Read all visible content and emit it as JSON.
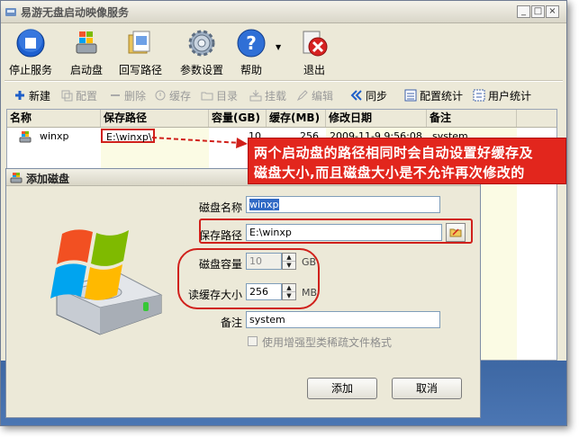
{
  "window": {
    "title": "易游无盘启动映像服务"
  },
  "toolbar": [
    {
      "label": "停止服务",
      "icon": "stop-service-icon"
    },
    {
      "label": "启动盘",
      "icon": "boot-disk-icon"
    },
    {
      "label": "回写路径",
      "icon": "writeback-path-icon"
    },
    {
      "label": "参数设置",
      "icon": "settings-gear-icon"
    },
    {
      "label": "帮助",
      "icon": "help-icon"
    },
    {
      "label": "退出",
      "icon": "exit-icon"
    }
  ],
  "toolbar2": [
    {
      "label": "新建",
      "icon": "plus-icon",
      "enabled": true
    },
    {
      "label": "配置",
      "icon": "config-icon",
      "enabled": false
    },
    {
      "label": "删除",
      "icon": "minus-icon",
      "enabled": false
    },
    {
      "label": "缓存",
      "icon": "cache-icon",
      "enabled": false
    },
    {
      "label": "目录",
      "icon": "folder-icon",
      "enabled": false
    },
    {
      "label": "挂载",
      "icon": "mount-icon",
      "enabled": false
    },
    {
      "label": "编辑",
      "icon": "edit-icon",
      "enabled": false
    },
    {
      "label": "同步",
      "icon": "sync-icon",
      "enabled": true
    },
    {
      "label": "配置统计",
      "icon": "config-stats-icon",
      "enabled": true
    },
    {
      "label": "用户统计",
      "icon": "user-stats-icon",
      "enabled": true
    }
  ],
  "table": {
    "headers": [
      "名称",
      "保存路径",
      "容量(GB)",
      "缓存(MB)",
      "修改日期",
      "备注"
    ],
    "rows": [
      [
        "winxp",
        "E:\\winxp\\",
        "10",
        "256",
        "2009-11-9 9:56:08",
        "system"
      ]
    ]
  },
  "callout": {
    "line1": "两个启动盘的路径相同时会自动设置好缓存及",
    "line2": "磁盘大小,而且磁盘大小是不允许再次修改的"
  },
  "dialog": {
    "title": "添加磁盘",
    "disk_name_label": "磁盘名称",
    "disk_name_value": "winxp",
    "save_path_label": "保存路径",
    "save_path_value": "E:\\winxp",
    "capacity_label": "磁盘容量",
    "capacity_value": "10",
    "capacity_unit": "GB",
    "cache_label": "读缓存大小",
    "cache_value": "256",
    "cache_unit": "MB",
    "note_label": "备注",
    "note_value": "system",
    "sparse_checkbox_label": "使用增强型类稀疏文件格式",
    "ok_label": "添加",
    "cancel_label": "取消"
  },
  "colors": {
    "accent_red": "#e2261d",
    "bottom_band": "#3d67a3"
  }
}
